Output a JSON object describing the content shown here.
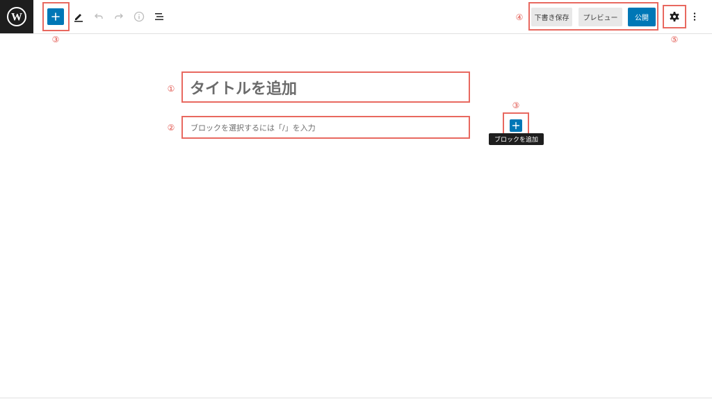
{
  "toolbar": {
    "logo_icon": "wordpress-logo-icon",
    "inserter_icon": "plus-icon",
    "tools_icon": "pencil-icon",
    "undo_icon": "undo-icon",
    "redo_icon": "redo-icon",
    "details_icon": "info-icon",
    "outline_icon": "list-view-icon",
    "save_draft_label": "下書き保存",
    "preview_label": "プレビュー",
    "publish_label": "公開",
    "settings_icon": "gear-icon",
    "options_icon": "more-vertical-icon"
  },
  "editor": {
    "title_placeholder": "タイトルを追加",
    "block_placeholder": "ブロックを選択するには「/」を入力",
    "inline_add_icon": "plus-icon",
    "tooltip": "ブロックを追加"
  },
  "annotations": {
    "one": "①",
    "two": "②",
    "three_top": "③",
    "three_inline": "③",
    "four": "④",
    "five": "⑤"
  },
  "colors": {
    "accent": "#0077b6",
    "annotation": "#e8685f",
    "dark": "#1e1e1e"
  }
}
